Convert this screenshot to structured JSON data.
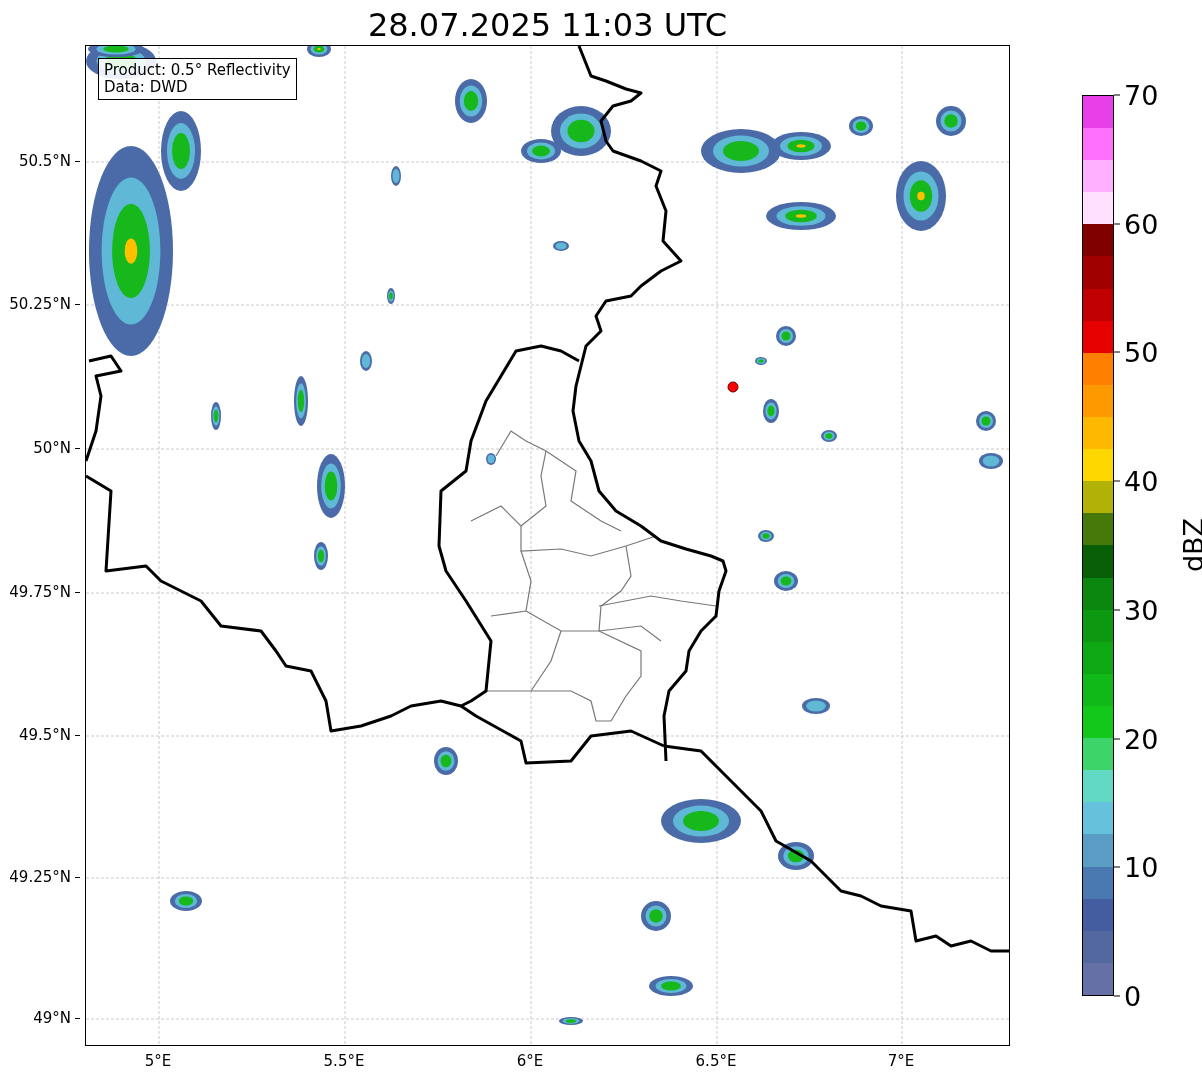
{
  "title": "28.07.2025 11:03 UTC",
  "map": {
    "legend": [
      "Product: 0.5° Reflectivity",
      "Data: DWD"
    ],
    "x_ticks": [
      "5°E",
      "5.5°E",
      "6°E",
      "6.5°E",
      "7°E"
    ],
    "y_ticks": [
      "50.5°N",
      "50.25°N",
      "50°N",
      "49.75°N",
      "49.5°N",
      "49.25°N",
      "49°N"
    ]
  },
  "colorbar": {
    "label": "dBZ",
    "ticks": [
      "70",
      "60",
      "50",
      "40",
      "30",
      "20",
      "10",
      "0"
    ],
    "segments": [
      {
        "color": "#6571a6"
      },
      {
        "color": "#53689e"
      },
      {
        "color": "#445da0"
      },
      {
        "color": "#4a78b0"
      },
      {
        "color": "#5a9cc4"
      },
      {
        "color": "#66c2dc"
      },
      {
        "color": "#62d9c4"
      },
      {
        "color": "#3dd56a"
      },
      {
        "color": "#12c81a"
      },
      {
        "color": "#10b818"
      },
      {
        "color": "#0fa815"
      },
      {
        "color": "#0d9812"
      },
      {
        "color": "#0b8710"
      },
      {
        "color": "#085f08"
      },
      {
        "color": "#47780a"
      },
      {
        "color": "#b0b205"
      },
      {
        "color": "#ffd700"
      },
      {
        "color": "#ffb800"
      },
      {
        "color": "#ff9900"
      },
      {
        "color": "#ff8000"
      },
      {
        "color": "#e60000"
      },
      {
        "color": "#c00000"
      },
      {
        "color": "#a00000"
      },
      {
        "color": "#800000"
      },
      {
        "color": "#ffe0ff"
      },
      {
        "color": "#ffb0ff"
      },
      {
        "color": "#ff70ff"
      },
      {
        "color": "#e840e8"
      }
    ]
  }
}
